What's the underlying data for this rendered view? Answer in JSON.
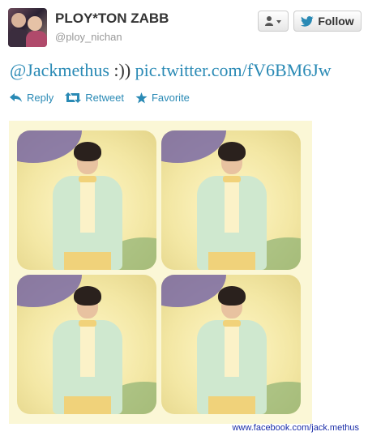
{
  "profile": {
    "name": "PLOY*TON ZABB",
    "handle": "@ploy_nichan"
  },
  "buttons": {
    "follow_label": "Follow"
  },
  "tweet": {
    "mention": "@Jackmethus",
    "emoticon": " :)) ",
    "link": "pic.twitter.com/fV6BM6Jw"
  },
  "actions": {
    "reply": "Reply",
    "retweet": "Retweet",
    "favorite": "Favorite"
  },
  "photo": {
    "watermark": "www.facebook.com/jack.methus"
  },
  "colors": {
    "link": "#2a8ab5",
    "twitter_bird": "#2a8ab5",
    "watermark": "#1a2da8"
  }
}
